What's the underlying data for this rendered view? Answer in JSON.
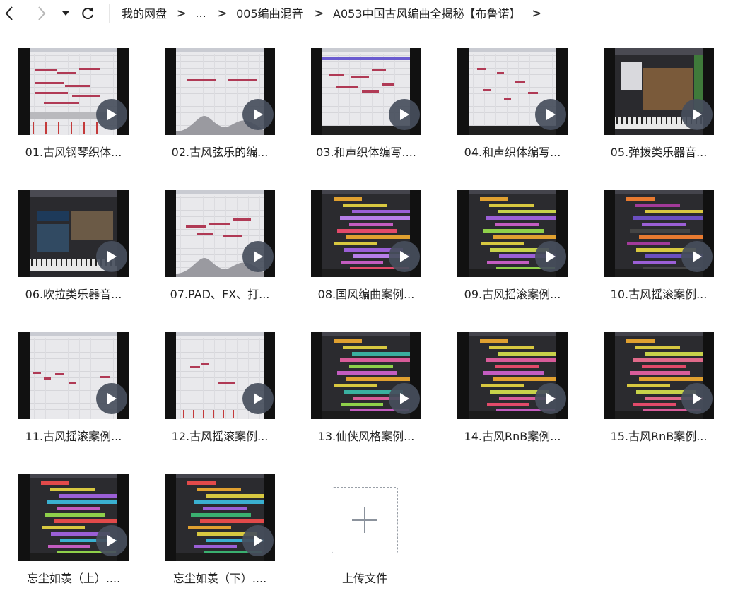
{
  "toolbar": {
    "back_icon": "chevron-left-icon",
    "forward_icon": "chevron-right-icon",
    "history_icon": "dropdown-caret-icon",
    "refresh_icon": "refresh-icon"
  },
  "breadcrumb": {
    "items": [
      "我的网盘",
      "...",
      "005编曲混音",
      "A053中国古风编曲全揭秘【布鲁诺】"
    ],
    "separator": ">"
  },
  "files": [
    {
      "name": "01.古风钢琴织体...",
      "thumb": "piano-roll"
    },
    {
      "name": "02.古风弦乐的编...",
      "thumb": "piano-roll-curve"
    },
    {
      "name": "03.和声织体编写....",
      "thumb": "piano-roll-purple"
    },
    {
      "name": "04.和声织体编写...",
      "thumb": "piano-roll-sparse"
    },
    {
      "name": "05.弹拨类乐器音...",
      "thumb": "plugin-ui"
    },
    {
      "name": "06.吹拉类乐器音...",
      "thumb": "plugin-cinemori"
    },
    {
      "name": "07.PAD、FX、打...",
      "thumb": "piano-roll-curve2"
    },
    {
      "name": "08.国风编曲案例...",
      "thumb": "arrange-a"
    },
    {
      "name": "09.古风摇滚案例...",
      "thumb": "arrange-b"
    },
    {
      "name": "10.古风摇滚案例...",
      "thumb": "arrange-c"
    },
    {
      "name": "11.古风摇滚案例...",
      "thumb": "piano-roll-light"
    },
    {
      "name": "12.古风摇滚案例...",
      "thumb": "piano-roll-few"
    },
    {
      "name": "13.仙侠风格案例...",
      "thumb": "arrange-d"
    },
    {
      "name": "14.古风RnB案例...",
      "thumb": "arrange-e"
    },
    {
      "name": "15.古风RnB案例...",
      "thumb": "arrange-f"
    },
    {
      "name": "忘尘如羡（上）....",
      "thumb": "arrange-g"
    },
    {
      "name": "忘尘如羡（下）....",
      "thumb": "arrange-h"
    }
  ],
  "upload": {
    "label": "上传文件",
    "icon": "plus-icon"
  },
  "colors": {
    "play_bg": "#464e5c",
    "thumb_bg": "#111111"
  }
}
